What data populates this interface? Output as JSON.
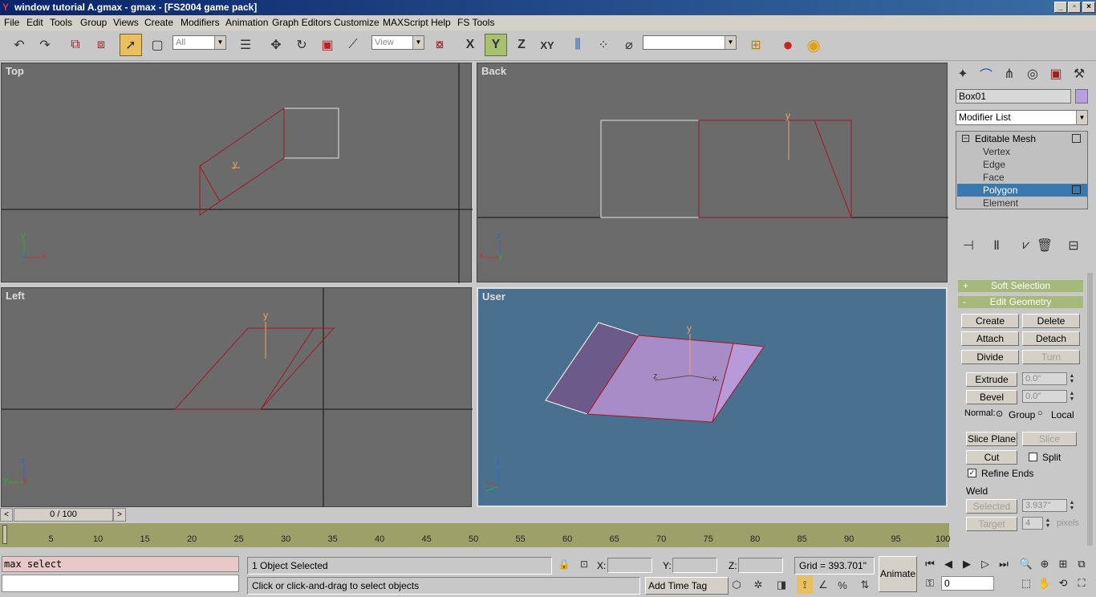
{
  "window": {
    "title": "window tutorial A.gmax - gmax - [FS2004 game pack]",
    "min": "_",
    "restore": "▫",
    "close": "×"
  },
  "menu": [
    "File",
    "Edit",
    "Tools",
    "Group",
    "Views",
    "Create",
    "Modifiers",
    "Animation",
    "Graph Editors",
    "Customize",
    "MAXScript",
    "Help",
    "FS Tools"
  ],
  "toolbar": {
    "selection_filter": "All",
    "coord_system": "View",
    "named_selection": "",
    "axis_x": "X",
    "axis_y": "Y",
    "axis_z": "Z",
    "axis_xy": "XY"
  },
  "viewports": {
    "top": "Top",
    "back": "Back",
    "left": "Left",
    "user": "User"
  },
  "axis_letters": {
    "x": "x",
    "y": "y",
    "z": "z"
  },
  "panel": {
    "object_name": "Box01",
    "object_color": "#b8a0e0",
    "modifier_list": "Modifier List",
    "stack": [
      "Editable Mesh",
      "Vertex",
      "Edge",
      "Face",
      "Polygon",
      "Element"
    ],
    "selected_stack_item": "Polygon",
    "soft_selection": {
      "sign": "+",
      "label": "Soft Selection"
    },
    "edit_geometry": {
      "sign": "-",
      "label": "Edit Geometry"
    },
    "buttons": {
      "create": "Create",
      "delete": "Delete",
      "attach": "Attach",
      "detach": "Detach",
      "divide": "Divide",
      "turn": "Turn",
      "extrude": "Extrude",
      "bevel": "Bevel",
      "slice_plane": "Slice Plane",
      "slice": "Slice",
      "cut": "Cut",
      "selected": "Selected",
      "target": "Target"
    },
    "extrude_value": "0.0\"",
    "bevel_value": "0.0\"",
    "normal_label": "Normal:",
    "group_label": "Group",
    "local_label": "Local",
    "split_label": "Split",
    "refine_ends_label": "Refine Ends",
    "weld_label": "Weld",
    "weld_selected_value": "3.937\"",
    "weld_target_value": "4",
    "pixels_label": "pixels"
  },
  "timeline": {
    "position": "0 / 100",
    "ticks": [
      "5",
      "10",
      "15",
      "20",
      "25",
      "30",
      "35",
      "40",
      "45",
      "50",
      "55",
      "60",
      "65",
      "70",
      "75",
      "80",
      "85",
      "90",
      "95",
      "100"
    ]
  },
  "status": {
    "script_text": "max select",
    "selected": "1 Object Selected",
    "prompt": "Click or click-and-drag to select objects",
    "x_label": "X:",
    "y_label": "Y:",
    "z_label": "Z:",
    "grid": "Grid = 393.701\"",
    "animate": "Animate",
    "add_time_tag": "Add Time Tag",
    "frame": "0"
  },
  "colors": {
    "viewport": "#6b6b6b",
    "user_viewport": "#4a7090",
    "wire": "#a01828",
    "selection": "#3a78b0"
  }
}
